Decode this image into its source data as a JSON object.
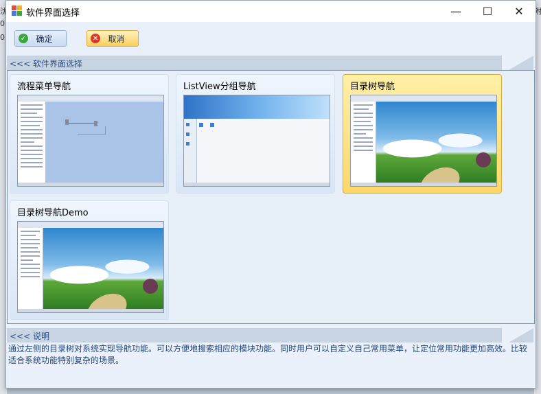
{
  "window": {
    "title": "软件界面选择",
    "controls": {
      "minimize": "—",
      "maximize": "☐",
      "close": "✕"
    }
  },
  "background_app": {
    "fragments": [
      "沈",
      "0",
      "0"
    ],
    "right_fragment": "附"
  },
  "toolbar": {
    "ok_label": "确定",
    "cancel_label": "取消"
  },
  "sections": {
    "gallery_header": "<<< 软件界面选择",
    "desc_header": "<<< 说明"
  },
  "cards": [
    {
      "title": "流程菜单导航",
      "selected": false,
      "thumb": "flow"
    },
    {
      "title": "ListView分组导航",
      "selected": false,
      "thumb": "listview"
    },
    {
      "title": "目录树导航",
      "selected": true,
      "thumb": "landscape"
    },
    {
      "title": "目录树导航Demo",
      "selected": false,
      "thumb": "landscape"
    }
  ],
  "description": "通过左侧的目录树对系统实现导航功能。可以方便地搜索相应的模块功能。同时用户可以自定义自己常用菜单，让定位常用功能更加高效。比较适合系统功能特别复杂的场景。",
  "colors": {
    "accent_header_text": "#2e4f86",
    "selected_card": "#ffd768",
    "ok_icon": "#3aa83a",
    "cancel_icon": "#d93b2b"
  }
}
